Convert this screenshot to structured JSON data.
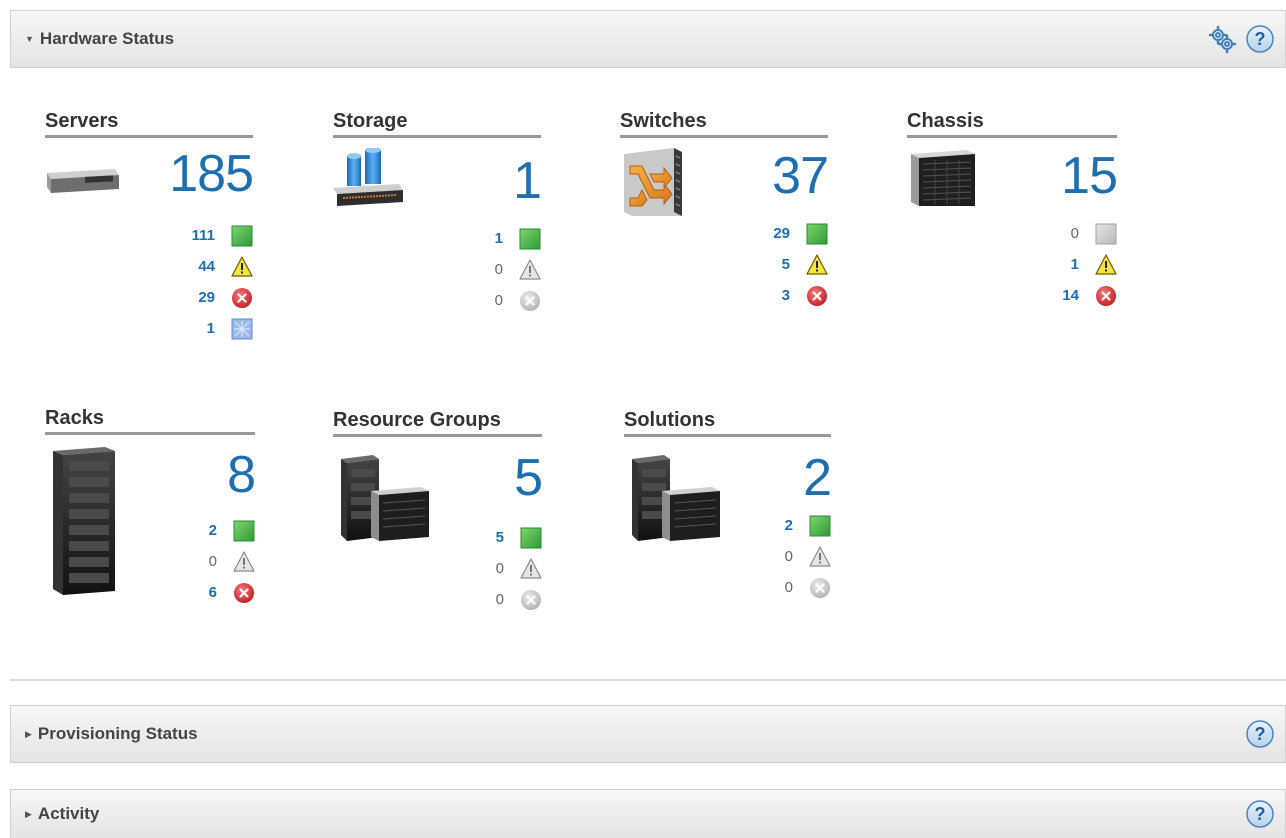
{
  "sections": {
    "hardware": {
      "title": "Hardware Status",
      "expanded": true
    },
    "provisioning": {
      "title": "Provisioning Status",
      "expanded": false
    },
    "activity": {
      "title": "Activity",
      "expanded": false
    }
  },
  "icons": {
    "settings": "gear-icon",
    "help": "help-icon",
    "normal": "normal-status-icon",
    "warning": "warning-status-icon",
    "critical": "critical-status-icon",
    "unknown": "unknown-status-icon"
  },
  "colors": {
    "accent": "#1d6fb0",
    "normal": "#3cb043",
    "warning": "#f3e53a",
    "critical": "#d9262c",
    "disabled": "#bdbdbd"
  },
  "tiles": {
    "servers": {
      "title": "Servers",
      "total": "185",
      "normal": "111",
      "warning": "44",
      "critical": "29",
      "other": "1"
    },
    "storage": {
      "title": "Storage",
      "total": "1",
      "normal": "1",
      "warning": "0",
      "critical": "0"
    },
    "switches": {
      "title": "Switches",
      "total": "37",
      "normal": "29",
      "warning": "5",
      "critical": "3"
    },
    "chassis": {
      "title": "Chassis",
      "total": "15",
      "normal": "0",
      "warning": "1",
      "critical": "14"
    },
    "racks": {
      "title": "Racks",
      "total": "8",
      "normal": "2",
      "warning": "0",
      "critical": "6"
    },
    "resource_groups": {
      "title": "Resource Groups",
      "total": "5",
      "normal": "5",
      "warning": "0",
      "critical": "0"
    },
    "solutions": {
      "title": "Solutions",
      "total": "2",
      "normal": "2",
      "warning": "0",
      "critical": "0"
    }
  }
}
